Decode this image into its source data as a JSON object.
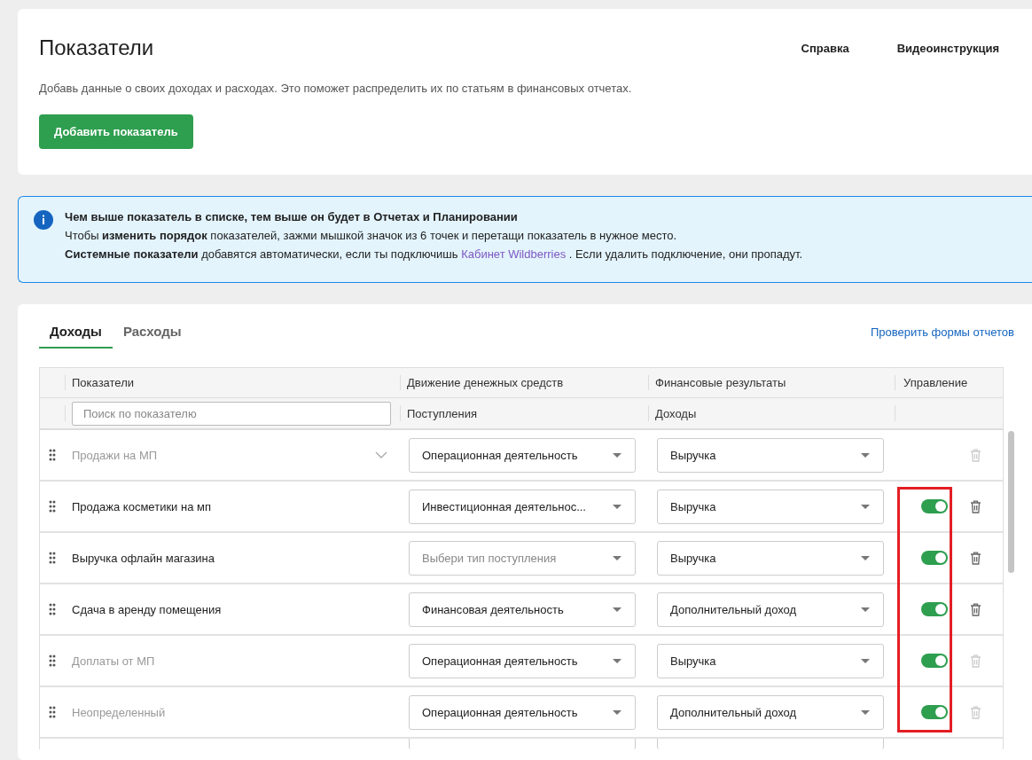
{
  "header": {
    "title": "Показатели",
    "links": [
      "Справка",
      "Видеоинструкция"
    ],
    "description": "Добавь данные о своих доходах и расходах. Это поможет распределить их по статьям в финансовых отчетах.",
    "add_button": "Добавить показатель"
  },
  "info": {
    "title": "Чем выше показатель в списке, тем выше он будет в Отчетах и Планировании",
    "line_1": "Чтобы **изменить порядок** показателей, зажми мышкой значок из 6 точек и перетащи показатель в нужное место.",
    "line_2_before": "**Системные показатели** добавятся автоматически, если ты подключишь",
    "line_2_link": "Кабинет Wildberries",
    "line_2_after": " . Если удалить подключение, они пропадут."
  },
  "tabs": [
    {
      "label": "Доходы",
      "selected": true
    },
    {
      "label": "Расходы",
      "selected": false
    }
  ],
  "check_link": "Проверить формы отчетов",
  "table": {
    "columns": [
      "Показатели",
      "Движение денежных средств",
      "Финансовые результаты",
      "Управление"
    ],
    "filters": {
      "search_placeholder": "Поиск по показателю",
      "cashflow": "Поступления",
      "results": "Доходы"
    },
    "management_highlighted": true,
    "rows": [
      {
        "kind": "parent",
        "name": "Продажи на МП",
        "system": true,
        "cashflow": "Операционная деятельность",
        "results": "Выручка"
      },
      {
        "kind": "item",
        "name": "Продажа косметики на мп",
        "system": false,
        "cashflow": "Инвестиционная деятельнос...",
        "results": "Выручка",
        "on": true
      },
      {
        "kind": "item",
        "name": "Выручка офлайн магазина",
        "system": false,
        "cashflow_placeholder": "Выбери тип поступления",
        "results": "Выручка",
        "on": true
      },
      {
        "kind": "item",
        "name": "Сдача в аренду помещения",
        "system": false,
        "cashflow": "Финансовая деятельность",
        "results": "Дополнительный доход",
        "on": true
      },
      {
        "kind": "item",
        "name": "Доплаты от МП",
        "system": true,
        "cashflow": "Операционная деятельность",
        "results": "Выручка",
        "on": true
      },
      {
        "kind": "item",
        "name": "Неопределенный",
        "system": true,
        "cashflow": "Операционная деятельность",
        "results": "Дополнительный доход",
        "on": true
      }
    ]
  }
}
